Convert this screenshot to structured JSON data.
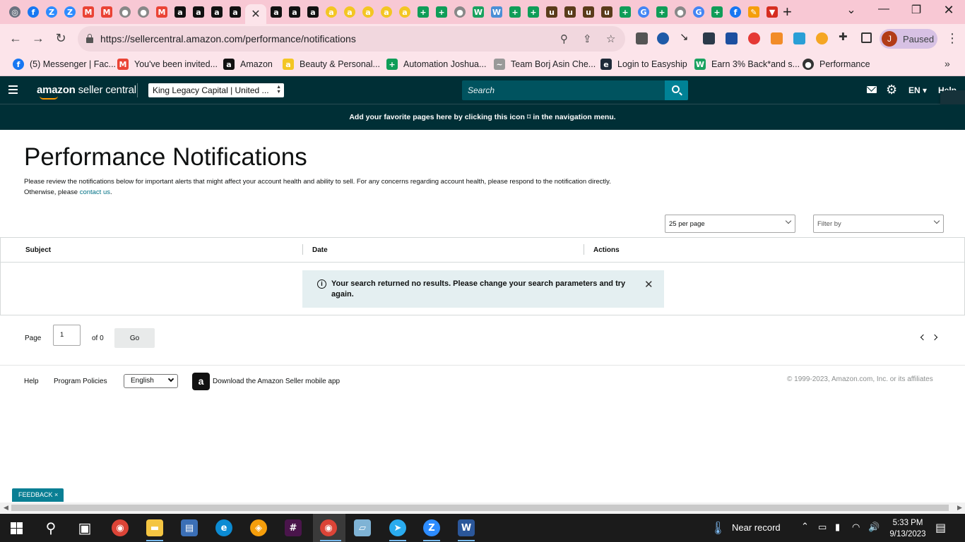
{
  "browser": {
    "tab_icons": [
      {
        "name": "chrome-icon",
        "bg": "#6b7280",
        "glyph": "◎",
        "round": true
      },
      {
        "name": "facebook-icon",
        "bg": "#1877f2",
        "glyph": "f",
        "round": true
      },
      {
        "name": "zoom-icon",
        "bg": "#2d8cff",
        "glyph": "Z",
        "round": true
      },
      {
        "name": "zoom-icon",
        "bg": "#2d8cff",
        "glyph": "Z",
        "round": true
      },
      {
        "name": "gmail-icon",
        "bg": "#ea4335",
        "glyph": "M",
        "round": false
      },
      {
        "name": "gmail-icon",
        "bg": "#ea4335",
        "glyph": "M",
        "round": false
      },
      {
        "name": "globe-icon",
        "bg": "#888888",
        "glyph": "●",
        "round": true
      },
      {
        "name": "globe-icon",
        "bg": "#888888",
        "glyph": "●",
        "round": true
      },
      {
        "name": "gmail-icon",
        "bg": "#ea4335",
        "glyph": "M",
        "round": false
      },
      {
        "name": "amazon-icon",
        "bg": "#111111",
        "glyph": "a",
        "round": false
      },
      {
        "name": "amazon-icon",
        "bg": "#111111",
        "glyph": "a",
        "round": false
      },
      {
        "name": "amazon-icon",
        "bg": "#111111",
        "glyph": "a",
        "round": false
      },
      {
        "name": "amazon-icon",
        "bg": "#111111",
        "glyph": "a",
        "round": false
      }
    ],
    "tab_icons_right": [
      {
        "name": "amazon-icon",
        "bg": "#111111",
        "glyph": "a",
        "round": false
      },
      {
        "name": "amazon-icon",
        "bg": "#111111",
        "glyph": "a",
        "round": false
      },
      {
        "name": "amazon-icon",
        "bg": "#111111",
        "glyph": "a",
        "round": false
      },
      {
        "name": "amazon-smile-icon",
        "bg": "#f3c623",
        "glyph": "a",
        "round": true
      },
      {
        "name": "amazon-smile-icon",
        "bg": "#f3c623",
        "glyph": "a",
        "round": true
      },
      {
        "name": "amazon-smile-icon",
        "bg": "#f3c623",
        "glyph": "a",
        "round": true
      },
      {
        "name": "amazon-smile-icon",
        "bg": "#f3c623",
        "glyph": "a",
        "round": true
      },
      {
        "name": "amazon-smile-icon",
        "bg": "#f3c623",
        "glyph": "a",
        "round": true
      },
      {
        "name": "sheets-icon",
        "bg": "#0f9d58",
        "glyph": "+",
        "round": false
      },
      {
        "name": "sheets-icon",
        "bg": "#0f9d58",
        "glyph": "+",
        "round": false
      },
      {
        "name": "globe-icon",
        "bg": "#888888",
        "glyph": "●",
        "round": true
      },
      {
        "name": "wix-icon",
        "bg": "#1aa260",
        "glyph": "W",
        "round": false
      },
      {
        "name": "wix-icon",
        "bg": "#4a8fd6",
        "glyph": "W",
        "round": false
      },
      {
        "name": "sheets-icon",
        "bg": "#0f9d58",
        "glyph": "+",
        "round": false
      },
      {
        "name": "sheets-icon",
        "bg": "#0f9d58",
        "glyph": "+",
        "round": false
      },
      {
        "name": "ups-icon",
        "bg": "#5a3b1a",
        "glyph": "u",
        "round": false
      },
      {
        "name": "ups-icon",
        "bg": "#5a3b1a",
        "glyph": "u",
        "round": false
      },
      {
        "name": "ups-icon",
        "bg": "#5a3b1a",
        "glyph": "u",
        "round": false
      },
      {
        "name": "ups-icon",
        "bg": "#5a3b1a",
        "glyph": "u",
        "round": false
      },
      {
        "name": "sheets-icon",
        "bg": "#0f9d58",
        "glyph": "+",
        "round": false
      },
      {
        "name": "google-icon",
        "bg": "#4285f4",
        "glyph": "G",
        "round": true
      },
      {
        "name": "sheets-icon",
        "bg": "#0f9d58",
        "glyph": "+",
        "round": false
      },
      {
        "name": "globe-icon",
        "bg": "#888888",
        "glyph": "●",
        "round": true
      },
      {
        "name": "google-icon",
        "bg": "#4285f4",
        "glyph": "G",
        "round": true
      },
      {
        "name": "sheets-icon",
        "bg": "#0f9d58",
        "glyph": "+",
        "round": false
      },
      {
        "name": "facebook-icon",
        "bg": "#1877f2",
        "glyph": "f",
        "round": true
      },
      {
        "name": "pencil-icon",
        "bg": "#f59e0b",
        "glyph": "✎",
        "round": false
      },
      {
        "name": "triangle-icon",
        "bg": "#d62d20",
        "glyph": "▼",
        "round": false
      }
    ],
    "url": "https://sellercentral.amazon.com/performance/notifications",
    "profile_initial": "J",
    "profile_status": "Paused",
    "bookmarks": [
      {
        "label": "(5) Messenger | Fac...",
        "icon": "facebook-icon",
        "bg": "#1877f2",
        "glyph": "f"
      },
      {
        "label": "You've been invited...",
        "icon": "gmail-icon",
        "bg": "#ea4335",
        "glyph": "M"
      },
      {
        "label": "Amazon",
        "icon": "amazon-icon",
        "bg": "#111111",
        "glyph": "a"
      },
      {
        "label": "Beauty & Personal...",
        "icon": "amazon-smile-icon",
        "bg": "#f3c623",
        "glyph": "a"
      },
      {
        "label": "Automation Joshua...",
        "icon": "sheets-icon",
        "bg": "#0f9d58",
        "glyph": "+"
      },
      {
        "label": "Team Borj Asin Che...",
        "icon": "team-icon",
        "bg": "#999999",
        "glyph": "~"
      },
      {
        "label": "Login to Easyship",
        "icon": "easyship-icon",
        "bg": "#1e2a38",
        "glyph": "e"
      },
      {
        "label": "Earn 3% Back*and s...",
        "icon": "wix-icon",
        "bg": "#1aa260",
        "glyph": "W"
      },
      {
        "label": "Performance",
        "icon": "globe-icon",
        "bg": "#333333",
        "glyph": "●"
      }
    ]
  },
  "header": {
    "logo_bold": "amazon",
    "logo_rest": " seller central",
    "account": "King Legacy Capital | United ...",
    "search_placeholder": "Search",
    "language": "EN ▾",
    "help": "Help"
  },
  "favorites_banner": "Add your favorite pages here by clicking this icon ⌑ in the navigation menu.",
  "main": {
    "title": "Performance Notifications",
    "intro": "Please review the notifications below for important alerts that might affect your account health and ability to sell. For any concerns regarding account health, please respond to the notification directly. Otherwise, please ",
    "contact_link": "contact us",
    "intro_end": ".",
    "per_page": "25 per page",
    "filter": "Filter by",
    "columns": [
      "Subject",
      "Date",
      "Actions"
    ],
    "alert_text": "Your search returned no results. Please change your search parameters and try again.",
    "pager": {
      "page_label": "Page",
      "page_value": "1",
      "of_label": "of 0",
      "go_label": "Go"
    }
  },
  "footer": {
    "help": "Help",
    "policies": "Program Policies",
    "language": "English",
    "app_link": "Download the Amazon Seller mobile app",
    "copyright": "© 1999-2023, Amazon.com, Inc. or its affiliates",
    "feedback": "FEEDBACK ×"
  },
  "taskbar": {
    "apps": [
      {
        "name": "search-icon",
        "bg": "transparent",
        "glyph": "⚲"
      },
      {
        "name": "task-view-icon",
        "bg": "transparent",
        "glyph": "▣"
      },
      {
        "name": "chrome-icon",
        "bg": "#db4437",
        "glyph": "◉"
      },
      {
        "name": "file-explorer-icon",
        "bg": "#f4c542",
        "glyph": "▬"
      },
      {
        "name": "control-panel-icon",
        "bg": "#3b6fb6",
        "glyph": "▤"
      },
      {
        "name": "edge-icon",
        "bg": "#0c8bd3",
        "glyph": "e"
      },
      {
        "name": "vpn-icon",
        "bg": "#f59e0b",
        "glyph": "◈"
      },
      {
        "name": "slack-icon",
        "bg": "#4a154b",
        "glyph": "#"
      },
      {
        "name": "chrome-profile-icon",
        "bg": "#db4437",
        "glyph": "◉"
      },
      {
        "name": "notepad-icon",
        "bg": "#7fb3d5",
        "glyph": "▱"
      },
      {
        "name": "telegram-icon",
        "bg": "#2aabee",
        "glyph": "➤"
      },
      {
        "name": "zoom-icon",
        "bg": "#2d8cff",
        "glyph": "Z"
      },
      {
        "name": "word-icon",
        "bg": "#2b579a",
        "glyph": "W"
      }
    ],
    "weather": "Near record",
    "time": "5:33 PM",
    "date": "9/13/2023"
  }
}
